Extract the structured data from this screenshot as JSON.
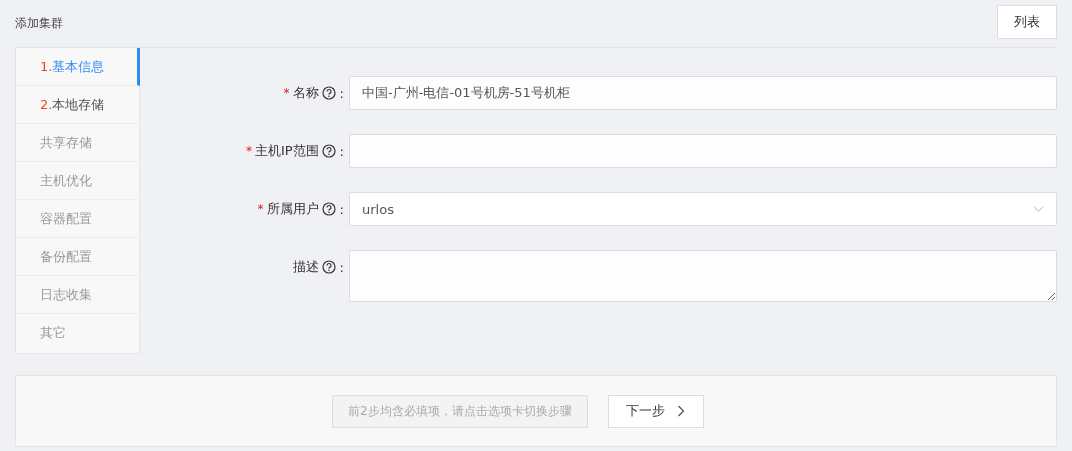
{
  "page_title": "添加集群",
  "list_button": "列表",
  "steps": [
    {
      "number": "1.",
      "label": "基本信息",
      "selected": true,
      "disabled": false
    },
    {
      "number": "2.",
      "label": "本地存储",
      "selected": false,
      "disabled": false
    },
    {
      "label": "共享存储",
      "selected": false,
      "disabled": true
    },
    {
      "label": "主机优化",
      "selected": false,
      "disabled": true
    },
    {
      "label": "容器配置",
      "selected": false,
      "disabled": true
    },
    {
      "label": "备份配置",
      "selected": false,
      "disabled": true
    },
    {
      "label": "日志收集",
      "selected": false,
      "disabled": true
    },
    {
      "label": "其它",
      "selected": false,
      "disabled": true
    }
  ],
  "fields": [
    {
      "kind": "input",
      "required_mark": "*",
      "label": "名称",
      "colon": ":",
      "value": "中国-广州-电信-01号机房-51号机柜"
    },
    {
      "kind": "input",
      "required_mark": "*",
      "label": "主机IP范围",
      "colon": ":"
    },
    {
      "kind": "select",
      "required_mark": "*",
      "label": "所属用户",
      "colon": ":",
      "value": "urlos"
    },
    {
      "kind": "textarea",
      "label": "描述",
      "colon": ":"
    }
  ],
  "footer": {
    "hint": "前2步均含必填项，请点击选项卡切换步骤",
    "next_button": "下一步"
  }
}
